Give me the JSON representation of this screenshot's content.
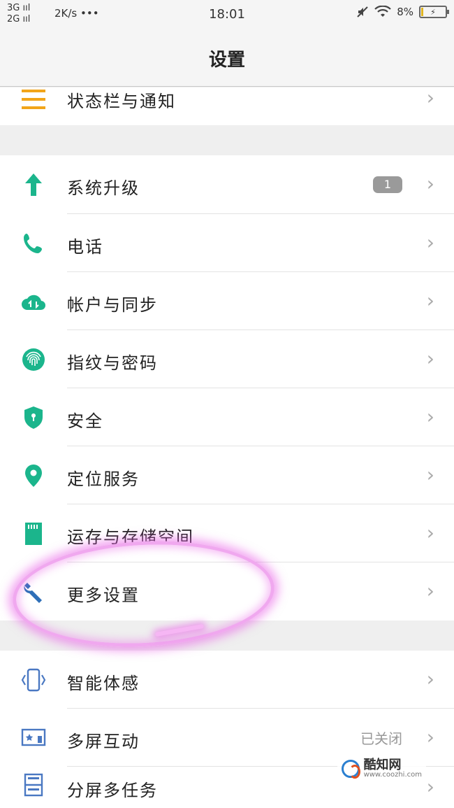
{
  "status_bar": {
    "net1": "3G ııl",
    "net2": "2G ııl",
    "speed": "2K/s •••",
    "time": "18:01",
    "battery_pct": "8%",
    "battery_level": 0.08,
    "bolt": "⚡"
  },
  "title": "设置",
  "rows": [
    {
      "label": "状态栏与通知",
      "chev": "›"
    },
    {
      "label": "系统升级",
      "chev": "›",
      "badge": "1"
    },
    {
      "label": "电话",
      "chev": "›"
    },
    {
      "label": "帐户与同步",
      "chev": "›"
    },
    {
      "label": "指纹与密码",
      "chev": "›"
    },
    {
      "label": "安全",
      "chev": "›"
    },
    {
      "label": "定位服务",
      "chev": "›"
    },
    {
      "label": "运存与存储空间",
      "chev": "›"
    },
    {
      "label": "更多设置",
      "chev": "›"
    },
    {
      "label": "智能体感",
      "chev": "›"
    },
    {
      "label": "多屏互动",
      "chev": "›",
      "status": "已关闭"
    },
    {
      "label": "分屏多任务",
      "chev": "›"
    }
  ],
  "icons": {
    "status_bar": "menu-lines-icon",
    "upgrade": "arrow-up-icon",
    "phone": "phone-icon",
    "account": "cloud-sync-icon",
    "fingerprint": "fingerprint-icon",
    "security": "shield-lock-icon",
    "location": "location-pin-icon",
    "storage": "sd-card-icon",
    "more": "wrench-icon",
    "smart_motion": "phone-vibrate-icon",
    "multiscreen": "cast-screen-icon",
    "split_screen": "split-screen-icon"
  },
  "colors": {
    "accent_green": "#1bb58c",
    "accent_orange": "#f2a51a",
    "accent_blue": "#4a78c2",
    "highlight_pink": "#e85ae6"
  },
  "watermark": {
    "name": "酷知网",
    "url": "www.coozhi.com"
  }
}
